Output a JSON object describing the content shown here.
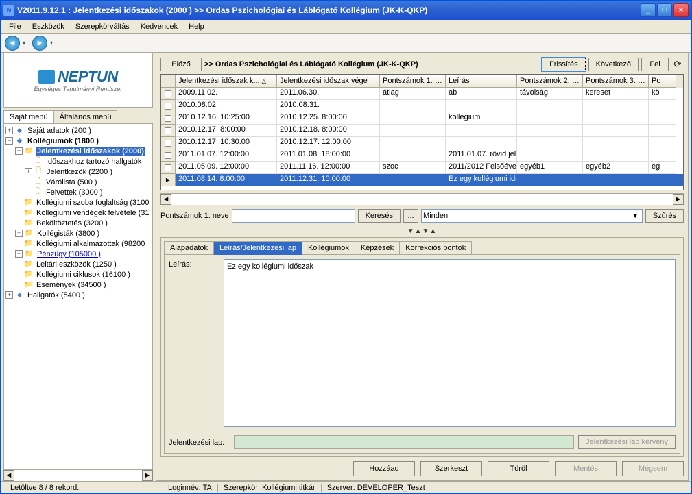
{
  "window": {
    "title": "V2011.9.12.1 : Jelentkezési időszakok (2000 )  >> Ordas Pszichológiai és Láblógató Kollégium (JK-K-QKP)"
  },
  "menubar": [
    "File",
    "Eszközök",
    "Szerepkörváltás",
    "Kedvencek",
    "Help"
  ],
  "logo": {
    "brand": "NEPTUN",
    "sub": "Egységes Tanulmányi Rendszer"
  },
  "treeTabs": {
    "active": "Saját menü",
    "other": "Általános menü"
  },
  "tree": {
    "sajat": "Saját adatok (200  )",
    "koll": "Kollégiumok (1800  )",
    "jelentkezesi": "Jelentkezési időszakok (2000)",
    "idoszakhoz": "Időszakhoz tartozó hallgatók",
    "jelentkezok": "Jelentkezők (2200  )",
    "varolista": "Várólista (500  )",
    "felvettek": "Felvettek (3000  )",
    "szoba": "Kollégiumi szoba foglaltság (3100",
    "vendeg": "Kollégiumi vendégek felvétele (31",
    "bekoltoztes": "Beköltöztetés (3200  )",
    "kollegistak": "Kollégisták (3800  )",
    "alk": "Kollégiumi alkalmazottak (98200",
    "penzugy": "Pénzügy (105000  )",
    "leltari": "Leltári eszközök (1250  )",
    "ciklus": "Kollégiumi ciklusok (16100  )",
    "esemeny": "Események (34500  )",
    "hallgatok": "Hallgatók (5400  )"
  },
  "topbar": {
    "elozo": "Előző",
    "breadcrumb": ">>  Ordas Pszichológiai és Láblógató Kollégium (JK-K-QKP)",
    "frissites": "Frissítés",
    "kovetkezo": "Következő",
    "fel": "Fel"
  },
  "grid": {
    "headers": [
      "Jelentkezési időszak k...",
      "Jelentkezési időszak vége",
      "Pontszámok 1. ne...",
      "Leírás",
      "Pontszámok 2. ne...",
      "Pontszámok 3. ne...",
      "Po"
    ],
    "rows": [
      [
        "2009.11.02.",
        "2011.06.30.",
        "átlag",
        "ab",
        "távolság",
        "kereset",
        "kö"
      ],
      [
        "2010.08.02.",
        "2010.08.31.",
        "",
        "",
        "",
        "",
        ""
      ],
      [
        "2010.12.16. 10:25:00",
        "2010.12.25. 8:00:00",
        "",
        "kollégium",
        "",
        "",
        ""
      ],
      [
        "2010.12.17. 8:00:00",
        "2010.12.18. 8:00:00",
        "",
        "",
        "",
        "",
        ""
      ],
      [
        "2010.12.17. 10:30:00",
        "2010.12.17. 12:00:00",
        "",
        "",
        "",
        "",
        ""
      ],
      [
        "2011.01.07. 12:00:00",
        "2011.01.08. 18:00:00",
        "",
        "2011.01.07. rövid jel",
        "",
        "",
        ""
      ],
      [
        "2011.05.09. 12:00:00",
        "2011.11.16. 12:00:00",
        "szoc",
        "2011/2012 Felsőéve",
        "egyéb1",
        "egyéb2",
        "eg"
      ],
      [
        "2011.08.14. 8:00:00",
        "2011.12.31. 10:00:00",
        "",
        "Ez egy kollégiumi idő",
        "",
        "",
        ""
      ]
    ],
    "selected": 7
  },
  "search": {
    "label": "Pontszámok 1. neve",
    "kereses": "Keresés",
    "dots": "...",
    "combo": "Minden",
    "szures": "Szűrés"
  },
  "detailTabs": [
    "Alapadatok",
    "Leírás/Jelentkezési lap",
    "Kollégiumok",
    "Képzések",
    "Korrekciós pontok"
  ],
  "detailTabActive": 1,
  "detail": {
    "leirasLabel": "Leírás:",
    "leirasValue": "Ez egy kollégiumi időszak",
    "jelLapLabel": "Jelentkezési lap:",
    "jelLapBtn": "Jelentkezési lap kérvény"
  },
  "actions": {
    "hozzaad": "Hozzáad",
    "szerkeszt": "Szerkeszt",
    "torol": "Töröl",
    "mentes": "Mentés",
    "megsem": "Mégsem"
  },
  "status": {
    "records": "Letöltve 8 / 8 rekord.",
    "login": "Loginnév: TA",
    "role": "Szerepkör: Kollégiumi titkár",
    "server": "Szerver: DEVELOPER_Teszt"
  }
}
